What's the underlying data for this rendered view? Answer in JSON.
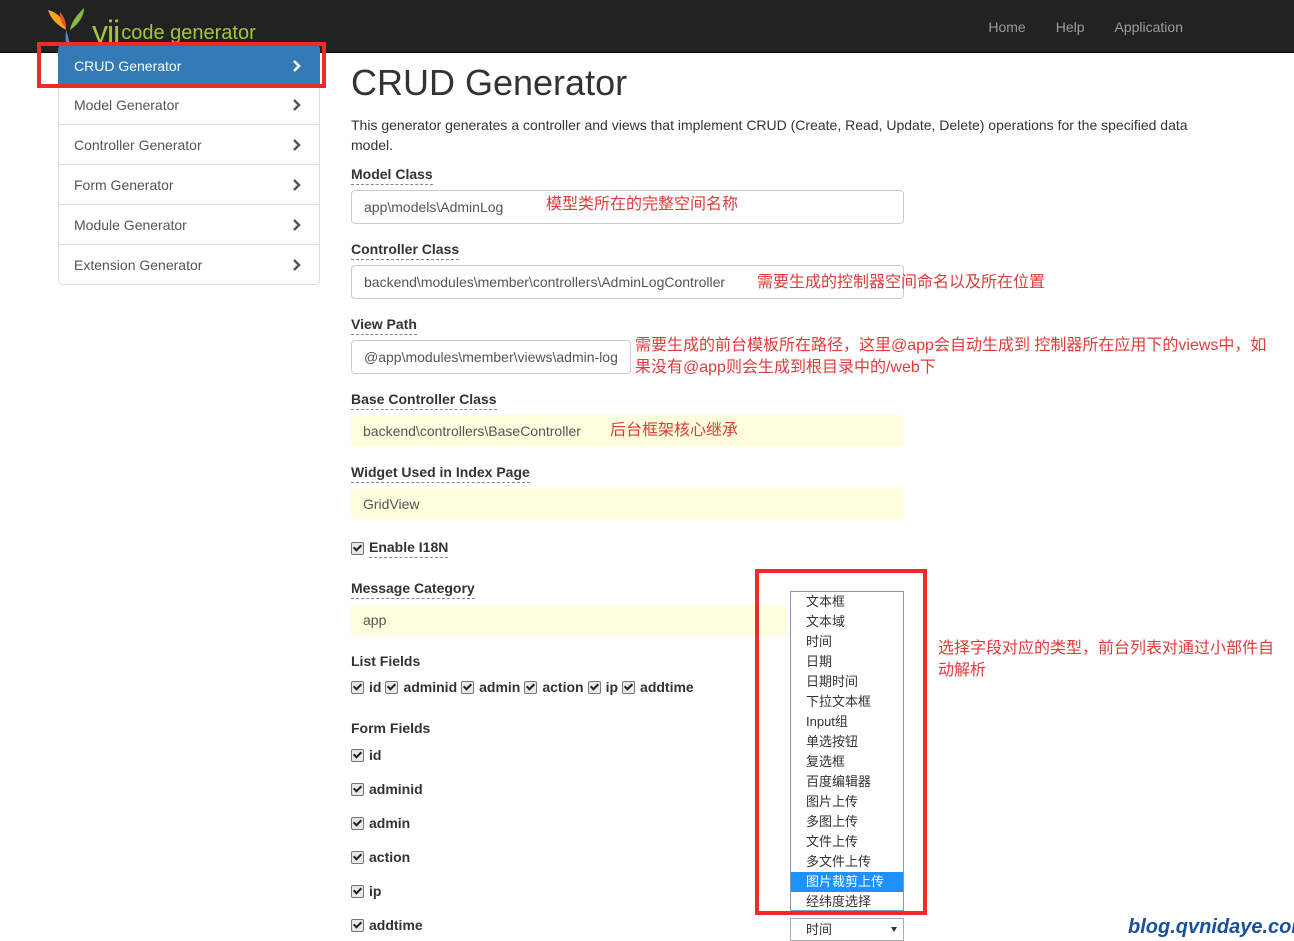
{
  "navbar": {
    "logo_mark": "yii",
    "logo_text": "code generator",
    "links": [
      "Home",
      "Help",
      "Application"
    ]
  },
  "sidebar": {
    "items": [
      {
        "label": "CRUD Generator",
        "active": true
      },
      {
        "label": "Model Generator"
      },
      {
        "label": "Controller Generator"
      },
      {
        "label": "Form Generator"
      },
      {
        "label": "Module Generator"
      },
      {
        "label": "Extension Generator"
      }
    ]
  },
  "main": {
    "title": "CRUD Generator",
    "description": "This generator generates a controller and views that implement CRUD (Create, Read, Update, Delete) operations for the specified data model.",
    "model_class": {
      "label": "Model Class",
      "value": "app\\models\\AdminLog",
      "note": "模型类所在的完整空间名称"
    },
    "controller_class": {
      "label": "Controller Class",
      "value": "backend\\modules\\member\\controllers\\AdminLogController",
      "note": "需要生成的控制器空间命名以及所在位置"
    },
    "view_path": {
      "label": "View Path",
      "value": "@app\\modules\\member\\views\\admin-log",
      "note_line1": "需要生成的前台模板所在路径，这里@app会自动生成到 控制器所在应用下的views中，如",
      "note_line2": "果没有@app则会生成到根目录中的/web下"
    },
    "base_controller": {
      "label": "Base Controller Class",
      "value": "backend\\controllers\\BaseController",
      "note": "后台框架核心继承"
    },
    "widget": {
      "label": "Widget Used in Index Page",
      "value": "GridView"
    },
    "enable_i18n": {
      "label": "Enable I18N",
      "checked": true
    },
    "message_category": {
      "label": "Message Category",
      "value": "app"
    },
    "list_fields": {
      "label": "List Fields",
      "items": [
        "id",
        "adminid",
        "admin",
        "action",
        "ip",
        "addtime"
      ]
    },
    "form_fields": {
      "label": "Form Fields",
      "items": [
        "id",
        "adminid",
        "admin",
        "action",
        "ip",
        "addtime"
      ]
    },
    "type_dropdown": {
      "options": [
        "文本框",
        "文本域",
        "时间",
        "日期",
        "日期时间",
        "下拉文本框",
        "Input组",
        "单选按钮",
        "复选框",
        "百度编辑器",
        "图片上传",
        "多图上传",
        "文件上传",
        "多文件上传",
        "图片裁剪上传",
        "经纬度选择"
      ],
      "highlighted": "图片裁剪上传",
      "selected_value": "时间",
      "note_line1": "选择字段对应的类型，前台列表对通过小部件自",
      "note_line2": "动解析"
    }
  },
  "watermark": "blog.qvnidaye.com",
  "colors": {
    "accent": "#337ab7",
    "annotation": "#e03b3b",
    "highlight_box": "#ee2a2a",
    "navbar": "#222222"
  }
}
